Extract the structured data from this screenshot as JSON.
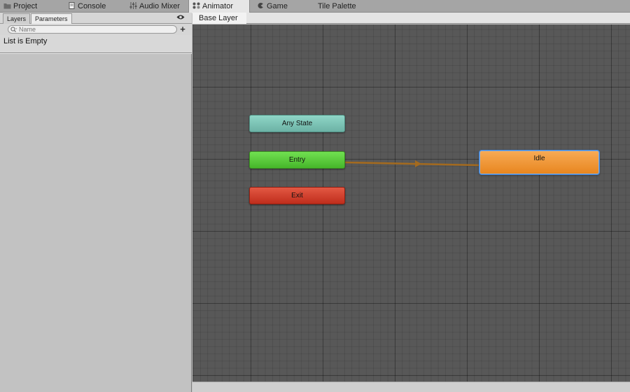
{
  "tabs": [
    {
      "label": "Project",
      "icon": "folder-icon"
    },
    {
      "label": "Console",
      "icon": "console-icon"
    },
    {
      "label": "Audio Mixer",
      "icon": "mixer-icon"
    },
    {
      "label": "Animator",
      "icon": "animator-icon",
      "active": true
    },
    {
      "label": "Game",
      "icon": "game-icon"
    },
    {
      "label": "Tile Palette",
      "icon": ""
    }
  ],
  "left_panel": {
    "subtabs": [
      {
        "label": "Layers"
      },
      {
        "label": "Parameters",
        "active": true
      }
    ],
    "search": {
      "placeholder": "Name",
      "value": ""
    },
    "add_button": "+",
    "empty_text": "List is Empty"
  },
  "breadcrumb": {
    "layer": "Base Layer"
  },
  "graph": {
    "states": [
      {
        "id": "any_state",
        "label": "Any State",
        "color": "#7dc5b7"
      },
      {
        "id": "entry",
        "label": "Entry",
        "color": "#5fce3d"
      },
      {
        "id": "exit",
        "label": "Exit",
        "color": "#d23f2c"
      },
      {
        "id": "idle",
        "label": "Idle",
        "color": "#f0982f",
        "default": true
      }
    ],
    "transitions": [
      {
        "from": "entry",
        "to": "idle",
        "color": "#a36a1f"
      }
    ]
  },
  "colors": {
    "canvas": "#585858",
    "selection": "#3f7fd1"
  }
}
